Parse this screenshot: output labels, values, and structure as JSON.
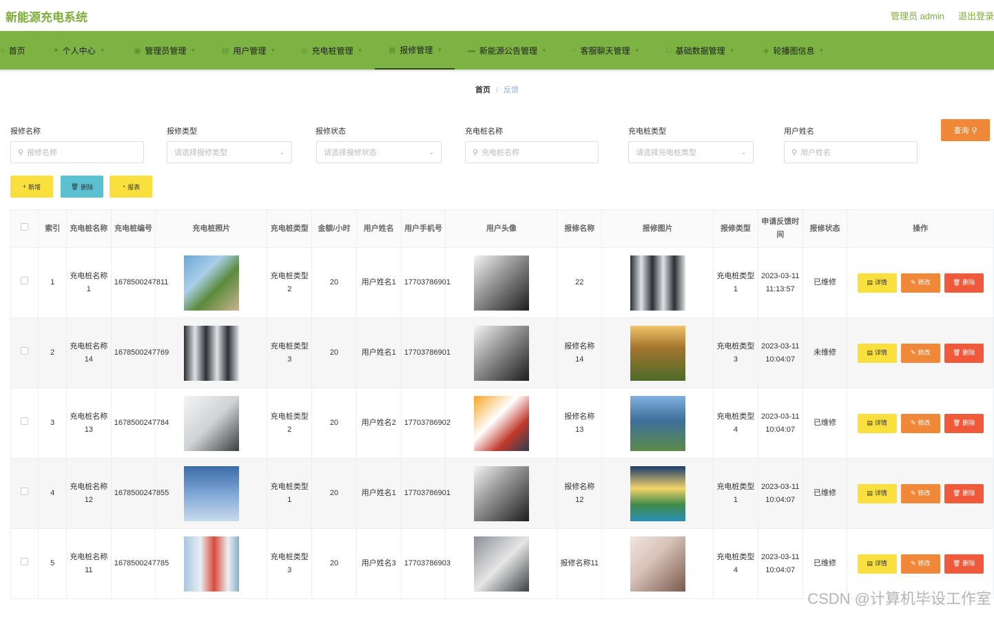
{
  "header": {
    "title": "新能源充电系统",
    "admin_label": "管理员 admin",
    "logout_label": "退出登录"
  },
  "nav": [
    {
      "label": "首页",
      "icon": "home-icon",
      "has_menu": false
    },
    {
      "label": "个人中心",
      "icon": "user-icon",
      "has_menu": true
    },
    {
      "label": "管理员管理",
      "icon": "admin-icon",
      "has_menu": true
    },
    {
      "label": "用户管理",
      "icon": "users-icon",
      "has_menu": true
    },
    {
      "label": "充电桩管理",
      "icon": "charger-icon",
      "has_menu": true
    },
    {
      "label": "报修管理",
      "icon": "repair-icon",
      "has_menu": true,
      "active": true
    },
    {
      "label": "新能源公告管理",
      "icon": "notice-icon",
      "has_menu": true
    },
    {
      "label": "客服聊天管理",
      "icon": "chat-icon",
      "has_menu": true
    },
    {
      "label": "基础数据管理",
      "icon": "data-icon",
      "has_menu": true
    },
    {
      "label": "轮播图信息",
      "icon": "carousel-icon",
      "has_menu": true
    }
  ],
  "breadcrumb": {
    "home": "首页",
    "sep": "/",
    "current": "反馈"
  },
  "filters": {
    "repair_name": {
      "label": "报修名称",
      "placeholder": "报修名称"
    },
    "repair_type": {
      "label": "报修类型",
      "placeholder": "请选择报修类型"
    },
    "repair_status": {
      "label": "报修状态",
      "placeholder": "请选择报修状态"
    },
    "pile_name": {
      "label": "充电桩名称",
      "placeholder": "充电桩名称"
    },
    "pile_type": {
      "label": "充电桩类型",
      "placeholder": "请选择充电桩类型"
    },
    "user_name": {
      "label": "用户姓名",
      "placeholder": "用户姓名"
    },
    "query_label": "查询"
  },
  "actions": {
    "add": "新增",
    "delete": "删除",
    "report": "报表"
  },
  "table": {
    "headers": [
      "索引",
      "充电桩名称",
      "充电桩编号",
      "充电桩照片",
      "充电桩类型",
      "金额/小时",
      "用户姓名",
      "用户手机号",
      "用户头像",
      "报修名称",
      "报修图片",
      "报修类型",
      "申请反馈时间",
      "报修状态",
      "操作"
    ],
    "op_labels": {
      "detail": "详情",
      "edit": "修改",
      "remove": "删除"
    },
    "rows": [
      {
        "index": "1",
        "pile_name": "充电桩名称1",
        "pile_no": "1678500247811",
        "pile_type": "充电桩类型2",
        "price": "20",
        "user_name": "用户姓名1",
        "phone": "17703786901",
        "repair_name": "22",
        "repair_type": "充电桩类型1",
        "time": "2023-03-11 11:13:57",
        "status": "已维修"
      },
      {
        "index": "2",
        "pile_name": "充电桩名称14",
        "pile_no": "1678500247769",
        "pile_type": "充电桩类型3",
        "price": "20",
        "user_name": "用户姓名1",
        "phone": "17703786901",
        "repair_name": "报修名称14",
        "repair_type": "充电桩类型3",
        "time": "2023-03-11 10:04:07",
        "status": "未维修"
      },
      {
        "index": "3",
        "pile_name": "充电桩名称13",
        "pile_no": "1678500247784",
        "pile_type": "充电桩类型2",
        "price": "20",
        "user_name": "用户姓名2",
        "phone": "17703786902",
        "repair_name": "报修名称13",
        "repair_type": "充电桩类型4",
        "time": "2023-03-11 10:04:07",
        "status": "已维修"
      },
      {
        "index": "4",
        "pile_name": "充电桩名称12",
        "pile_no": "1678500247855",
        "pile_type": "充电桩类型1",
        "price": "20",
        "user_name": "用户姓名1",
        "phone": "17703786901",
        "repair_name": "报修名称12",
        "repair_type": "充电桩类型1",
        "time": "2023-03-11 10:04:07",
        "status": "已维修"
      },
      {
        "index": "5",
        "pile_name": "充电桩名称11",
        "pile_no": "1678500247785",
        "pile_type": "充电桩类型3",
        "price": "20",
        "user_name": "用户姓名3",
        "phone": "17703786903",
        "repair_name": "报修名称11",
        "repair_type": "充电桩类型4",
        "time": "2023-03-11 10:04:07",
        "status": "已维修"
      }
    ]
  },
  "watermark": "CSDN @计算机毕设工作室",
  "colors": {
    "brand_green": "#7cb342",
    "title_green": "#7dae3c",
    "query_orange": "#f0883a",
    "yellow": "#fae03c",
    "teal": "#5bc0cf",
    "red": "#f05a3a"
  }
}
